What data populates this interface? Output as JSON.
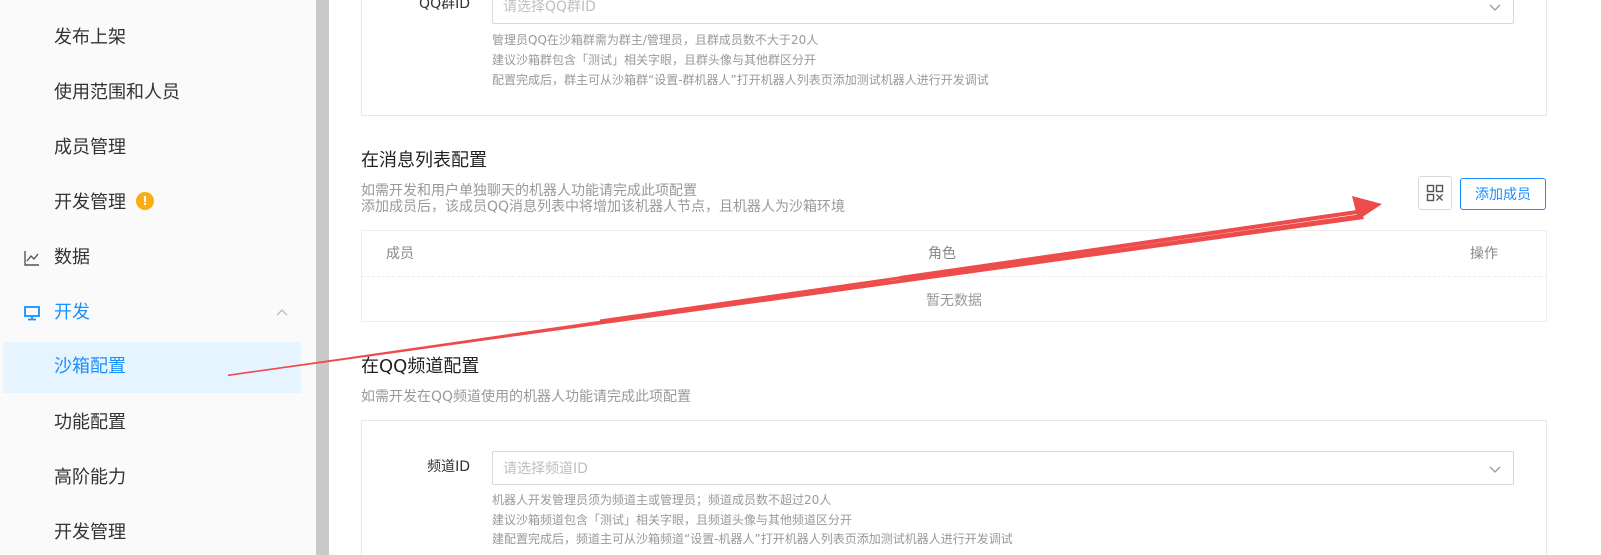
{
  "sidebar": {
    "items": [
      {
        "label": "发布上架"
      },
      {
        "label": "使用范围和人员"
      },
      {
        "label": "成员管理"
      },
      {
        "label": "开发管理",
        "badge": "!"
      }
    ],
    "groups": [
      {
        "label": "数据",
        "icon": "line-chart-icon"
      },
      {
        "label": "开发",
        "icon": "monitor-icon",
        "expanded": true
      }
    ],
    "sub_items": [
      {
        "label": "沙箱配置",
        "selected": true
      },
      {
        "label": "功能配置"
      },
      {
        "label": "高阶能力"
      },
      {
        "label": "开发管理"
      }
    ]
  },
  "qq_group_section": {
    "label": "QQ群ID",
    "placeholder": "请选择QQ群ID",
    "hints": [
      "管理员QQ在沙箱群需为群主/管理员，且群成员数不大于20人",
      "建议沙箱群包含「测试」相关字眼，且群头像与其他群区分开",
      "配置完成后，群主可从沙箱群“设置-群机器人”打开机器人列表页添加测试机器人进行开发调试"
    ]
  },
  "message_list_section": {
    "title": "在消息列表配置",
    "desc_lines": [
      "如需开发和用户单独聊天的机器人功能请完成此项配置",
      "添加成员后，该成员QQ消息列表中将增加该机器人节点，且机器人为沙箱环境"
    ],
    "add_button": "添加成员",
    "table": {
      "columns": [
        "成员",
        "角色",
        "操作"
      ],
      "empty_text": "暂无数据"
    }
  },
  "channel_section": {
    "title": "在QQ频道配置",
    "desc": "如需开发在QQ频道使用的机器人功能请完成此项配置",
    "label": "频道ID",
    "placeholder": "请选择频道ID",
    "hints": [
      "机器人开发管理员须为频道主或管理员；频道成员数不超过20人",
      "建议沙箱频道包含「测试」相关字眼，且频道头像与其他频道区分开",
      "建配置完成后，频道主可从沙箱频道“设置-机器人”打开机器人列表页添加测试机器人进行开发调试"
    ]
  },
  "colors": {
    "accent": "#1890ff",
    "annotation_arrow": "#ee4b4b",
    "badge": "#faad14"
  }
}
